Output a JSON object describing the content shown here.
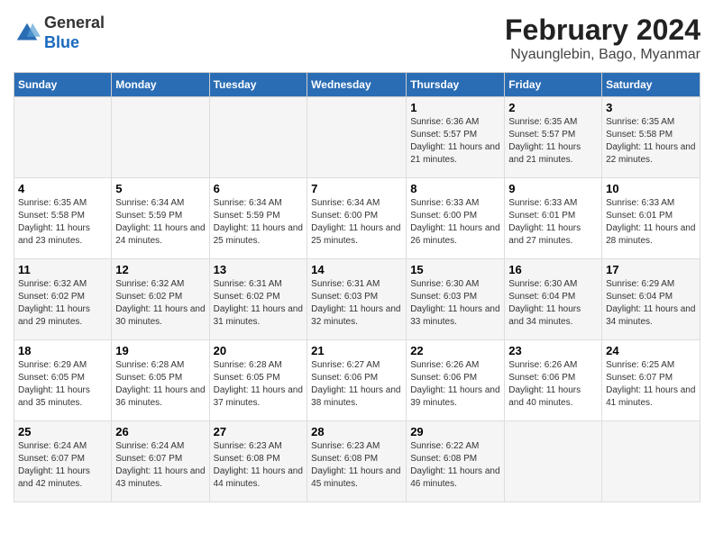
{
  "logo": {
    "general": "General",
    "blue": "Blue"
  },
  "title": "February 2024",
  "subtitle": "Nyaunglebin, Bago, Myanmar",
  "days": [
    "Sunday",
    "Monday",
    "Tuesday",
    "Wednesday",
    "Thursday",
    "Friday",
    "Saturday"
  ],
  "weeks": [
    [
      {
        "day": "",
        "content": ""
      },
      {
        "day": "",
        "content": ""
      },
      {
        "day": "",
        "content": ""
      },
      {
        "day": "",
        "content": ""
      },
      {
        "day": "1",
        "content": "Sunrise: 6:36 AM\nSunset: 5:57 PM\nDaylight: 11 hours and 21 minutes."
      },
      {
        "day": "2",
        "content": "Sunrise: 6:35 AM\nSunset: 5:57 PM\nDaylight: 11 hours and 21 minutes."
      },
      {
        "day": "3",
        "content": "Sunrise: 6:35 AM\nSunset: 5:58 PM\nDaylight: 11 hours and 22 minutes."
      }
    ],
    [
      {
        "day": "4",
        "content": "Sunrise: 6:35 AM\nSunset: 5:58 PM\nDaylight: 11 hours and 23 minutes."
      },
      {
        "day": "5",
        "content": "Sunrise: 6:34 AM\nSunset: 5:59 PM\nDaylight: 11 hours and 24 minutes."
      },
      {
        "day": "6",
        "content": "Sunrise: 6:34 AM\nSunset: 5:59 PM\nDaylight: 11 hours and 25 minutes."
      },
      {
        "day": "7",
        "content": "Sunrise: 6:34 AM\nSunset: 6:00 PM\nDaylight: 11 hours and 25 minutes."
      },
      {
        "day": "8",
        "content": "Sunrise: 6:33 AM\nSunset: 6:00 PM\nDaylight: 11 hours and 26 minutes."
      },
      {
        "day": "9",
        "content": "Sunrise: 6:33 AM\nSunset: 6:01 PM\nDaylight: 11 hours and 27 minutes."
      },
      {
        "day": "10",
        "content": "Sunrise: 6:33 AM\nSunset: 6:01 PM\nDaylight: 11 hours and 28 minutes."
      }
    ],
    [
      {
        "day": "11",
        "content": "Sunrise: 6:32 AM\nSunset: 6:02 PM\nDaylight: 11 hours and 29 minutes."
      },
      {
        "day": "12",
        "content": "Sunrise: 6:32 AM\nSunset: 6:02 PM\nDaylight: 11 hours and 30 minutes."
      },
      {
        "day": "13",
        "content": "Sunrise: 6:31 AM\nSunset: 6:02 PM\nDaylight: 11 hours and 31 minutes."
      },
      {
        "day": "14",
        "content": "Sunrise: 6:31 AM\nSunset: 6:03 PM\nDaylight: 11 hours and 32 minutes."
      },
      {
        "day": "15",
        "content": "Sunrise: 6:30 AM\nSunset: 6:03 PM\nDaylight: 11 hours and 33 minutes."
      },
      {
        "day": "16",
        "content": "Sunrise: 6:30 AM\nSunset: 6:04 PM\nDaylight: 11 hours and 34 minutes."
      },
      {
        "day": "17",
        "content": "Sunrise: 6:29 AM\nSunset: 6:04 PM\nDaylight: 11 hours and 34 minutes."
      }
    ],
    [
      {
        "day": "18",
        "content": "Sunrise: 6:29 AM\nSunset: 6:05 PM\nDaylight: 11 hours and 35 minutes."
      },
      {
        "day": "19",
        "content": "Sunrise: 6:28 AM\nSunset: 6:05 PM\nDaylight: 11 hours and 36 minutes."
      },
      {
        "day": "20",
        "content": "Sunrise: 6:28 AM\nSunset: 6:05 PM\nDaylight: 11 hours and 37 minutes."
      },
      {
        "day": "21",
        "content": "Sunrise: 6:27 AM\nSunset: 6:06 PM\nDaylight: 11 hours and 38 minutes."
      },
      {
        "day": "22",
        "content": "Sunrise: 6:26 AM\nSunset: 6:06 PM\nDaylight: 11 hours and 39 minutes."
      },
      {
        "day": "23",
        "content": "Sunrise: 6:26 AM\nSunset: 6:06 PM\nDaylight: 11 hours and 40 minutes."
      },
      {
        "day": "24",
        "content": "Sunrise: 6:25 AM\nSunset: 6:07 PM\nDaylight: 11 hours and 41 minutes."
      }
    ],
    [
      {
        "day": "25",
        "content": "Sunrise: 6:24 AM\nSunset: 6:07 PM\nDaylight: 11 hours and 42 minutes."
      },
      {
        "day": "26",
        "content": "Sunrise: 6:24 AM\nSunset: 6:07 PM\nDaylight: 11 hours and 43 minutes."
      },
      {
        "day": "27",
        "content": "Sunrise: 6:23 AM\nSunset: 6:08 PM\nDaylight: 11 hours and 44 minutes."
      },
      {
        "day": "28",
        "content": "Sunrise: 6:23 AM\nSunset: 6:08 PM\nDaylight: 11 hours and 45 minutes."
      },
      {
        "day": "29",
        "content": "Sunrise: 6:22 AM\nSunset: 6:08 PM\nDaylight: 11 hours and 46 minutes."
      },
      {
        "day": "",
        "content": ""
      },
      {
        "day": "",
        "content": ""
      }
    ]
  ]
}
